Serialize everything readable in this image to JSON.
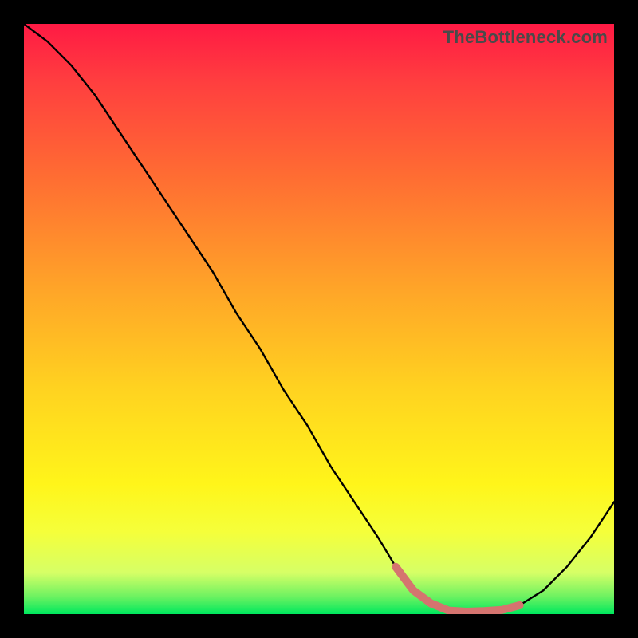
{
  "watermark": "TheBottleneck.com",
  "chart_data": {
    "type": "line",
    "title": "",
    "xlabel": "",
    "ylabel": "",
    "xlim": [
      0,
      100
    ],
    "ylim": [
      0,
      100
    ],
    "series": [
      {
        "name": "bottleneck-curve",
        "color": "#000000",
        "x": [
          0,
          4,
          8,
          12,
          16,
          20,
          24,
          28,
          32,
          36,
          40,
          44,
          48,
          52,
          56,
          60,
          63,
          66,
          69,
          72,
          75,
          78,
          81,
          84,
          88,
          92,
          96,
          100
        ],
        "y": [
          100,
          97,
          93,
          88,
          82,
          76,
          70,
          64,
          58,
          51,
          45,
          38,
          32,
          25,
          19,
          13,
          8,
          4,
          1.8,
          0.6,
          0.4,
          0.5,
          0.7,
          1.5,
          4,
          8,
          13,
          19
        ]
      },
      {
        "name": "highlight-segment",
        "color": "#d5746f",
        "x": [
          63,
          66,
          69,
          72,
          75,
          78,
          81,
          84
        ],
        "y": [
          8,
          4,
          1.8,
          0.6,
          0.4,
          0.5,
          0.7,
          1.5
        ]
      }
    ],
    "background_gradient": {
      "top": "#ff1a44",
      "bottom": "#00e85e"
    }
  }
}
